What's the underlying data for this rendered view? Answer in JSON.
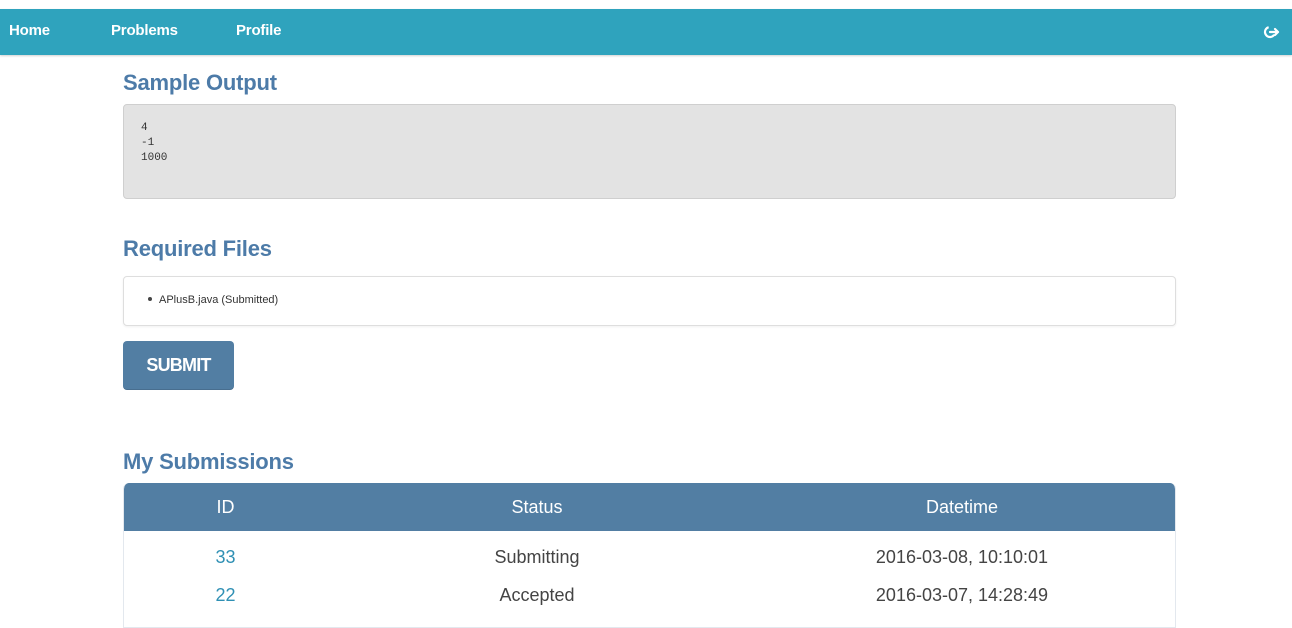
{
  "nav": {
    "items": [
      {
        "label": "Home"
      },
      {
        "label": "Problems"
      },
      {
        "label": "Profile"
      }
    ],
    "logout_icon": "logout-icon"
  },
  "sample_output": {
    "title": "Sample Output",
    "content": "4\n-1\n1000"
  },
  "required_files": {
    "title": "Required Files",
    "items": [
      "APlusB.java (Submitted)"
    ]
  },
  "submit_button": {
    "label": "SUBMIT"
  },
  "submissions": {
    "title": "My Submissions",
    "columns": [
      "ID",
      "Status",
      "Datetime"
    ],
    "rows": [
      {
        "id": "33",
        "status": "Submitting",
        "datetime": "2016-03-08, 10:10:01"
      },
      {
        "id": "22",
        "status": "Accepted",
        "datetime": "2016-03-07, 14:28:49"
      }
    ]
  },
  "colors": {
    "navbar": "#2fa3bd",
    "heading": "#4d7ba8",
    "button": "#527ea3",
    "link": "#2f90b4"
  }
}
